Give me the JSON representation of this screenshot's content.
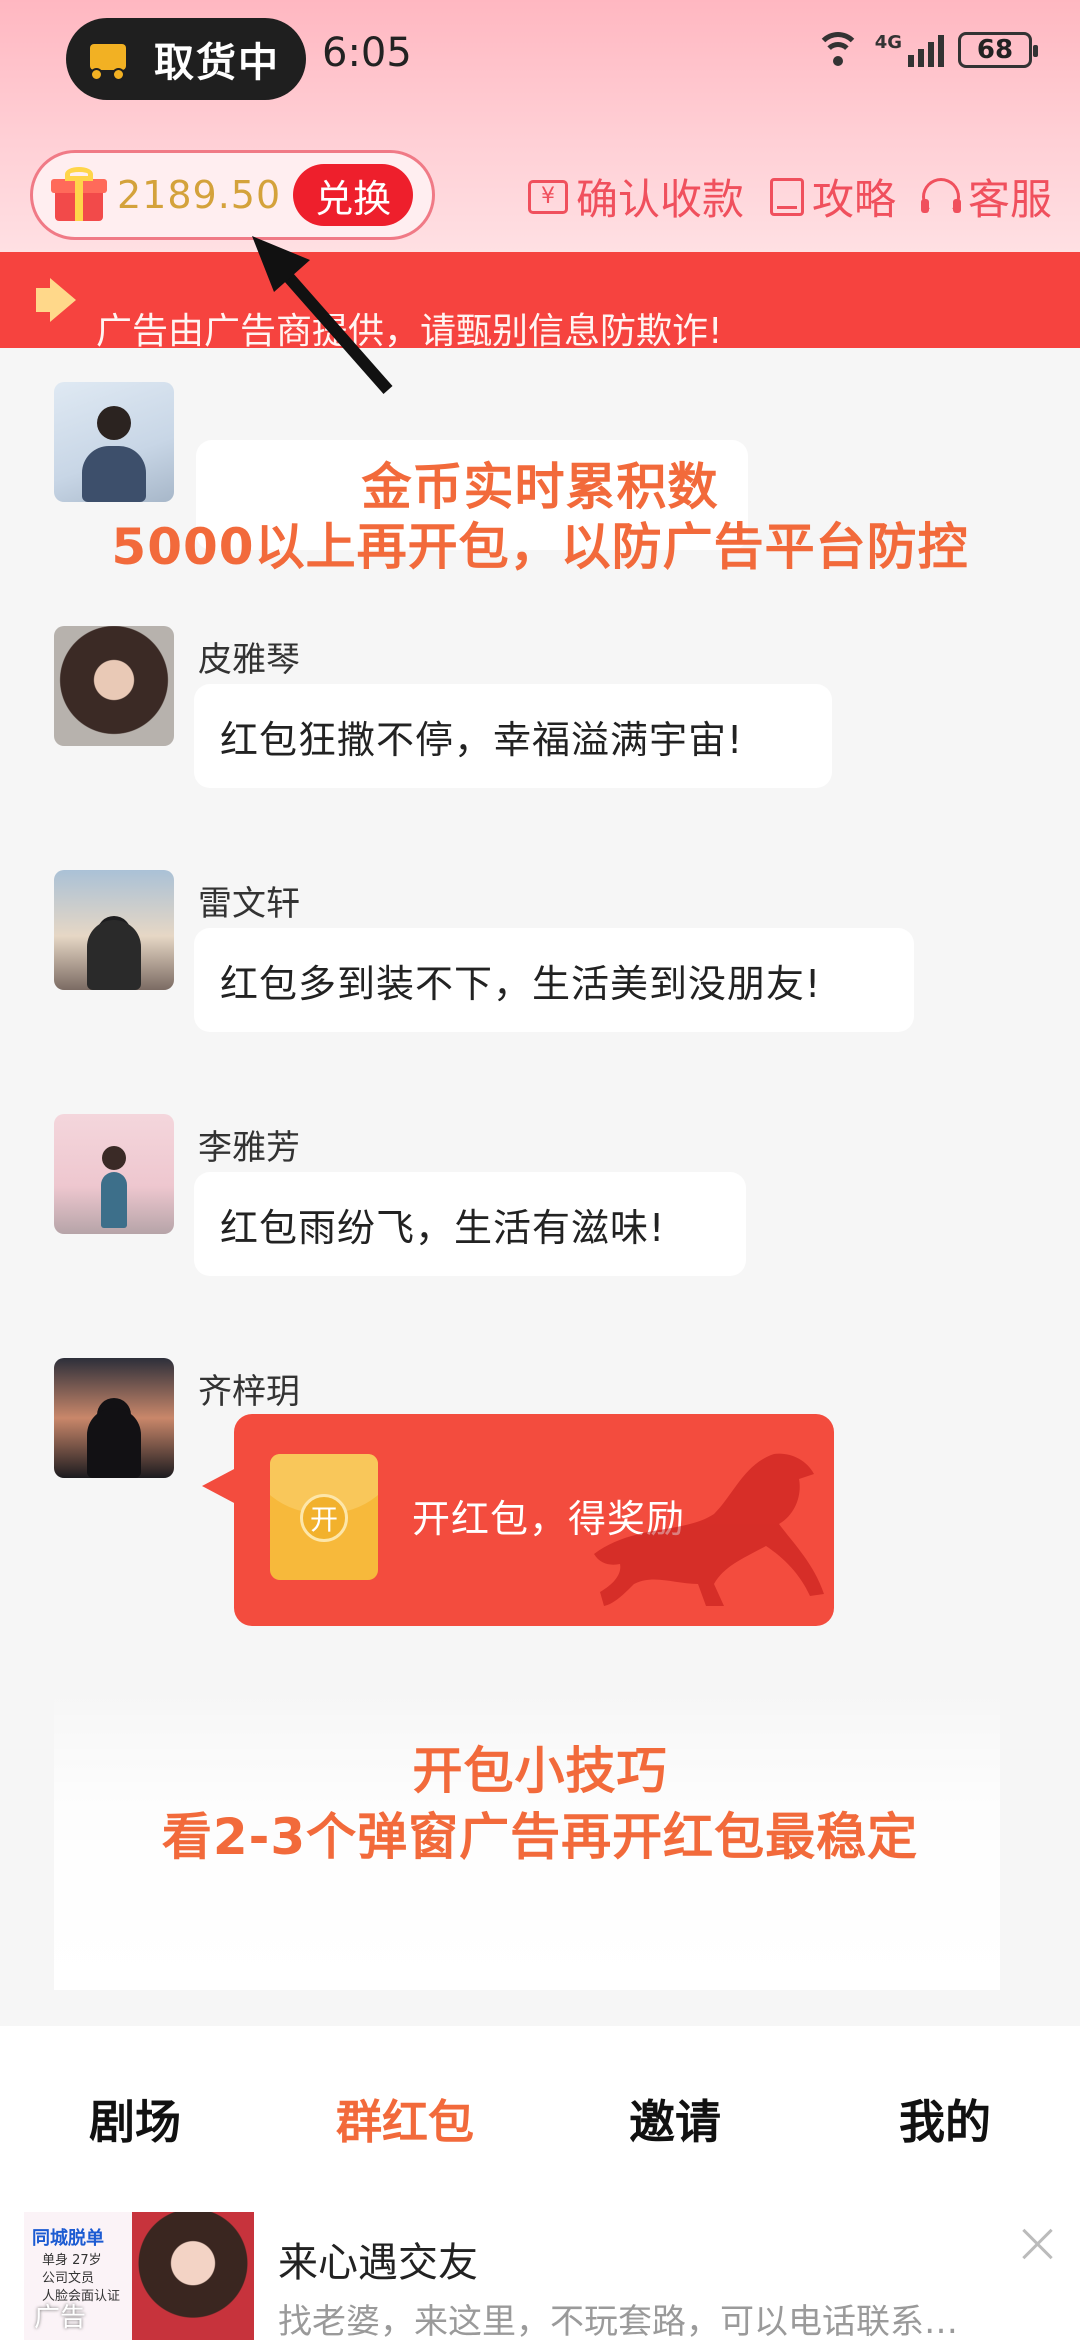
{
  "status_bar": {
    "pill_label": "取货中",
    "time": "6:05",
    "network": "4G",
    "battery": "68"
  },
  "header": {
    "coin_balance": "2189.50",
    "exchange_label": "兑换",
    "links": [
      "确认收款",
      "攻略",
      "客服"
    ]
  },
  "notice": {
    "text": "广告由广告商提供，请甄别信息防欺诈!"
  },
  "overlay": {
    "line1": "金币实时累积数",
    "line2": "5000以上再开包，以防广告平台防控",
    "tip1": "开包小技巧",
    "tip2": "看2-3个弹窗广告再开红包最稳定"
  },
  "chat": {
    "messages": [
      {
        "name": "皮雅琴",
        "text": "红包狂撒不停，幸福溢满宇宙!"
      },
      {
        "name": "雷文轩",
        "text": "红包多到装不下，生活美到没朋友!"
      },
      {
        "name": "李雅芳",
        "text": "红包雨纷飞，生活有滋味!"
      }
    ],
    "packet": {
      "sender": "齐梓玥",
      "open_glyph": "开",
      "label": "开红包，得奖励"
    }
  },
  "bottom_nav": {
    "items": [
      "剧场",
      "群红包",
      "邀请",
      "我的"
    ],
    "active": "群红包"
  },
  "ad": {
    "thumb_tag": "同城脱单",
    "thumb_lines": [
      "单身 27岁",
      "公司文员",
      "人脸会面认证"
    ],
    "thumb_label": "广告",
    "title": "来心遇交友",
    "subtitle": "找老婆，来这里，不玩套路，可以电话联系…"
  },
  "colors": {
    "accent_red": "#f6433f",
    "coin_gold": "#d4a23b",
    "annotation_orange": "#f26a3b",
    "link_red": "#f0505d"
  },
  "icons": [
    "truck-icon",
    "wifi-icon",
    "signal-icon",
    "battery-icon",
    "gift-icon",
    "yen-icon",
    "book-icon",
    "headset-icon",
    "speaker-icon",
    "close-icon"
  ]
}
